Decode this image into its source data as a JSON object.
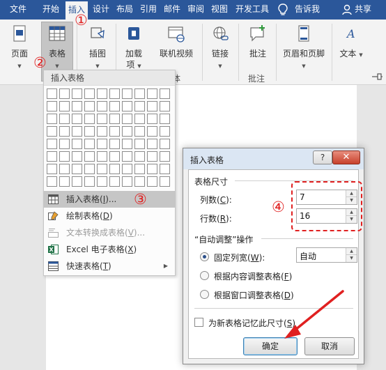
{
  "tabs": [
    {
      "label": "文件",
      "active": false
    },
    {
      "label": "开始",
      "active": false
    },
    {
      "label": "插入",
      "active": true
    },
    {
      "label": "设计",
      "active": false
    },
    {
      "label": "布局",
      "active": false
    },
    {
      "label": "引用",
      "active": false
    },
    {
      "label": "邮件",
      "active": false
    },
    {
      "label": "审阅",
      "active": false
    },
    {
      "label": "视图",
      "active": false
    },
    {
      "label": "开发工具",
      "active": false
    },
    {
      "label": "告诉我",
      "active": false,
      "icon": "lightbulb-icon"
    },
    {
      "label": "共享",
      "active": false,
      "icon": "person-icon"
    }
  ],
  "ribbon": {
    "page": {
      "label": "页面"
    },
    "table": {
      "label": "表格"
    },
    "illustrations": {
      "label": "插图"
    },
    "addins": {
      "label": "加载",
      "label2": "项"
    },
    "online_video": {
      "label": "联机视频"
    },
    "group_media_partial": "体",
    "link": {
      "label": "链接"
    },
    "comment": {
      "label": "批注"
    },
    "group_comment": "批注",
    "header_footer": {
      "label": "页眉和页脚"
    },
    "text": {
      "label": "文本"
    }
  },
  "dropdown": {
    "header": "插入表格",
    "grid": {
      "columns": 10,
      "rows": 8
    },
    "items": [
      {
        "text": "插入表格(",
        "key": "I",
        "suffix": ")...",
        "icon": "insert-table-icon",
        "highlighted": true,
        "disabled": false
      },
      {
        "text": "绘制表格(",
        "key": "D",
        "suffix": ")",
        "icon": "draw-table-pencil-icon",
        "highlighted": false,
        "disabled": false
      },
      {
        "text": "文本转换成表格(",
        "key": "V",
        "suffix": ")...",
        "icon": "text-to-table-icon",
        "highlighted": false,
        "disabled": true
      },
      {
        "text": "Excel 电子表格(",
        "key": "X",
        "suffix": ")",
        "icon": "excel-icon",
        "highlighted": false,
        "disabled": false
      },
      {
        "text": "快速表格(",
        "key": "T",
        "suffix": ")",
        "icon": "quick-table-icon",
        "highlighted": false,
        "disabled": false,
        "submenu": true
      }
    ]
  },
  "dialog": {
    "title": "插入表格",
    "help": "?",
    "table_size": {
      "section": "表格尺寸",
      "cols_label": "列数(",
      "cols_key": "C",
      "cols_suffix": "):",
      "cols_value": "7",
      "rows_label": "行数(",
      "rows_key": "R",
      "rows_suffix": "):",
      "rows_value": "16"
    },
    "autofit": {
      "section": "“自动调整”操作",
      "fixed": {
        "label": "固定列宽(",
        "key": "W",
        "suffix": "):",
        "selected": true
      },
      "fixed_value": "自动",
      "content": {
        "label": "根据内容调整表格(",
        "key": "F",
        "suffix": ")",
        "selected": false
      },
      "window": {
        "label": "根据窗口调整表格(",
        "key": "D",
        "suffix": ")",
        "selected": false
      }
    },
    "remember": {
      "label": "为新表格记忆此尺寸(",
      "key": "S",
      "suffix": ")",
      "checked": false
    },
    "ok": "确定",
    "cancel": "取消"
  },
  "annotations": [
    "①",
    "②",
    "③",
    "④"
  ],
  "colors": {
    "ribbon_blue": "#2b579a",
    "annotation_red": "#e02020"
  }
}
